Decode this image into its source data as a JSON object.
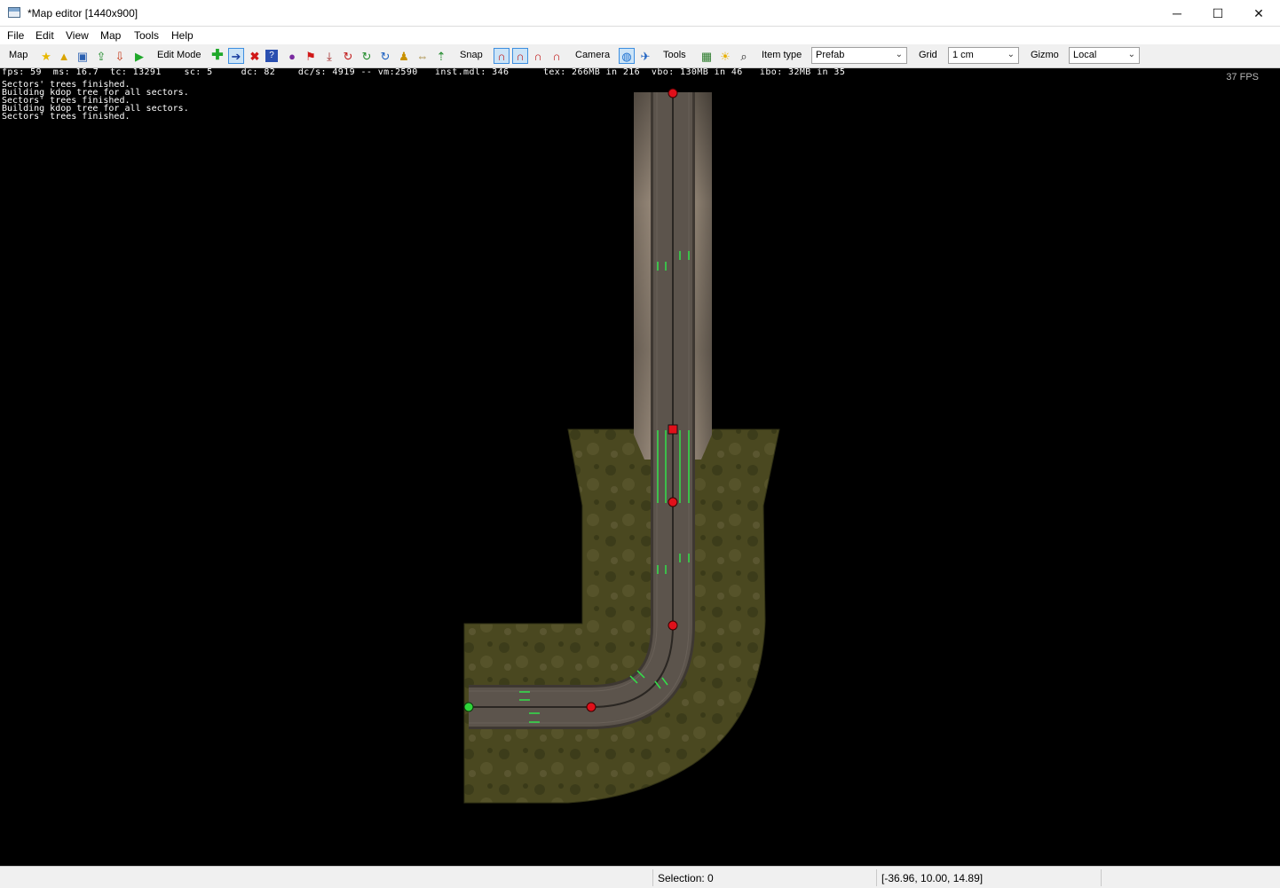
{
  "window": {
    "title": "*Map editor [1440x900]",
    "minimize_glyph": "─",
    "maximize_glyph": "☐",
    "close_glyph": "✕"
  },
  "menu": [
    "File",
    "Edit",
    "View",
    "Map",
    "Tools",
    "Help"
  ],
  "toolbar": {
    "map_label": "Map",
    "edit_mode_label": "Edit Mode",
    "snap_label": "Snap",
    "camera_label": "Camera",
    "tools_label": "Tools",
    "item_type_label": "Item type",
    "item_type_value": "Prefab",
    "grid_label": "Grid",
    "grid_value": "1 cm",
    "gizmo_label": "Gizmo",
    "gizmo_value": "Local"
  },
  "viewport": {
    "stats_line": "fps: 59  ms: 16.7  tc: 13291    sc: 5     dc: 82    dc/s: 4919 -- vm:2590   inst.mdl: 346      tex: 266MB in 216  vbo: 130MB in 46   ibo: 32MB in 35",
    "log": [
      "Sectors' trees finished.",
      "Building kdop tree for all sectors.",
      "Sectors' trees finished.",
      "Building kdop tree for all sectors.",
      "Sectors' trees finished."
    ],
    "fps_overlay": "37 FPS"
  },
  "status": {
    "selection": "Selection: 0",
    "coordinates": "[-36.96, 10.00, 14.89]"
  },
  "colors": {
    "node_red": "#e0101a",
    "node_green": "#2fd63a",
    "lane_arrow": "#32e24a",
    "terrain": "#4a4a22",
    "road": "#5a5048",
    "embankment": "#8a7d6c"
  }
}
